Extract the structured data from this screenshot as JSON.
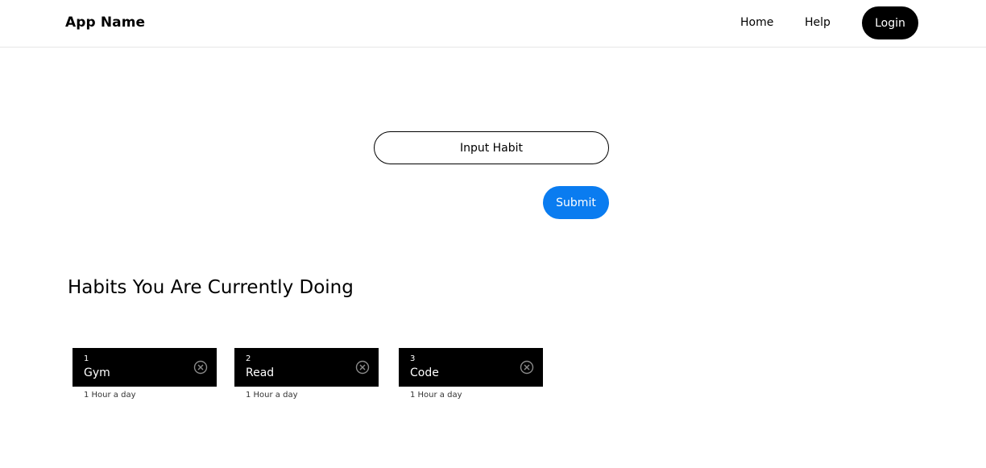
{
  "navbar": {
    "brand": "App Name",
    "links": [
      "Home",
      "Help"
    ],
    "login_label": "Login"
  },
  "form": {
    "input_placeholder": "Input Habit",
    "input_value": "",
    "submit_label": "Submit"
  },
  "habits_section": {
    "title": "Habits You Are Currently Doing",
    "items": [
      {
        "number": "1",
        "name": "Gym",
        "detail": "1 Hour a day"
      },
      {
        "number": "2",
        "name": "Read",
        "detail": "1 Hour a day"
      },
      {
        "number": "3",
        "name": "Code",
        "detail": "1 Hour a day"
      }
    ],
    "remove_icon": "circle-x-icon"
  },
  "colors": {
    "primary": "#0a7cf0",
    "dark": "#000000",
    "background": "#ffffff"
  }
}
